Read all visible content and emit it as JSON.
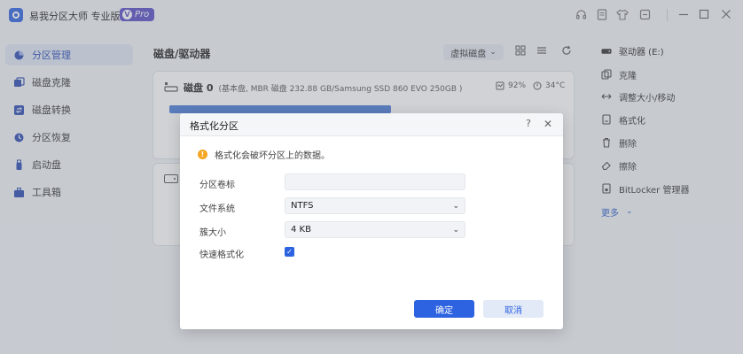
{
  "app": {
    "title": "易我分区大师 专业版",
    "badge": "Pro"
  },
  "titlebar_icons": [
    "headset-icon",
    "notes-icon",
    "shirt-icon",
    "feedback-icon",
    "minimize-icon",
    "maximize-icon",
    "close-icon"
  ],
  "sidebar": {
    "items": [
      {
        "label": "分区管理",
        "icon": "pie-chart-icon",
        "active": true
      },
      {
        "label": "磁盘克隆",
        "icon": "clone-icon",
        "active": false
      },
      {
        "label": "磁盘转换",
        "icon": "convert-icon",
        "active": false
      },
      {
        "label": "分区恢复",
        "icon": "recovery-icon",
        "active": false
      },
      {
        "label": "启动盘",
        "icon": "usb-icon",
        "active": false
      },
      {
        "label": "工具箱",
        "icon": "toolbox-icon",
        "active": false
      }
    ]
  },
  "main": {
    "title": "磁盘/驱动器",
    "vdisk_label": "虚拟磁盘",
    "disks": [
      {
        "name": "磁盘 0",
        "info": "(基本盘, MBR 磁盘 232.88 GB/Samsung SSD 860 EVO 250GB )",
        "health": "92%",
        "temp": "34°C"
      },
      {
        "name": "",
        "info": ""
      }
    ]
  },
  "rightpanel": {
    "drive": "驱动器 (E:)",
    "actions": [
      {
        "label": "克隆",
        "icon": "clone-icon"
      },
      {
        "label": "调整大小/移动",
        "icon": "resize-icon"
      },
      {
        "label": "格式化",
        "icon": "format-icon"
      },
      {
        "label": "删除",
        "icon": "delete-icon"
      },
      {
        "label": "擦除",
        "icon": "eraser-icon"
      },
      {
        "label": "BitLocker 管理器",
        "icon": "bitlocker-icon"
      }
    ],
    "more": "更多"
  },
  "dialog": {
    "title": "格式化分区",
    "warning": "格式化会破坏分区上的数据。",
    "fields": {
      "volume_label": {
        "label": "分区卷标",
        "value": ""
      },
      "file_system": {
        "label": "文件系统",
        "value": "NTFS"
      },
      "cluster_size": {
        "label": "簇大小",
        "value": "4 KB"
      },
      "quick_format": {
        "label": "快速格式化",
        "checked": true
      }
    },
    "ok": "确定",
    "cancel": "取消"
  },
  "colors": {
    "accent": "#2d63e0",
    "pro_badge": "#5a4ec7",
    "warning": "#f5a623",
    "disk_bar": "#4a7bd8"
  }
}
